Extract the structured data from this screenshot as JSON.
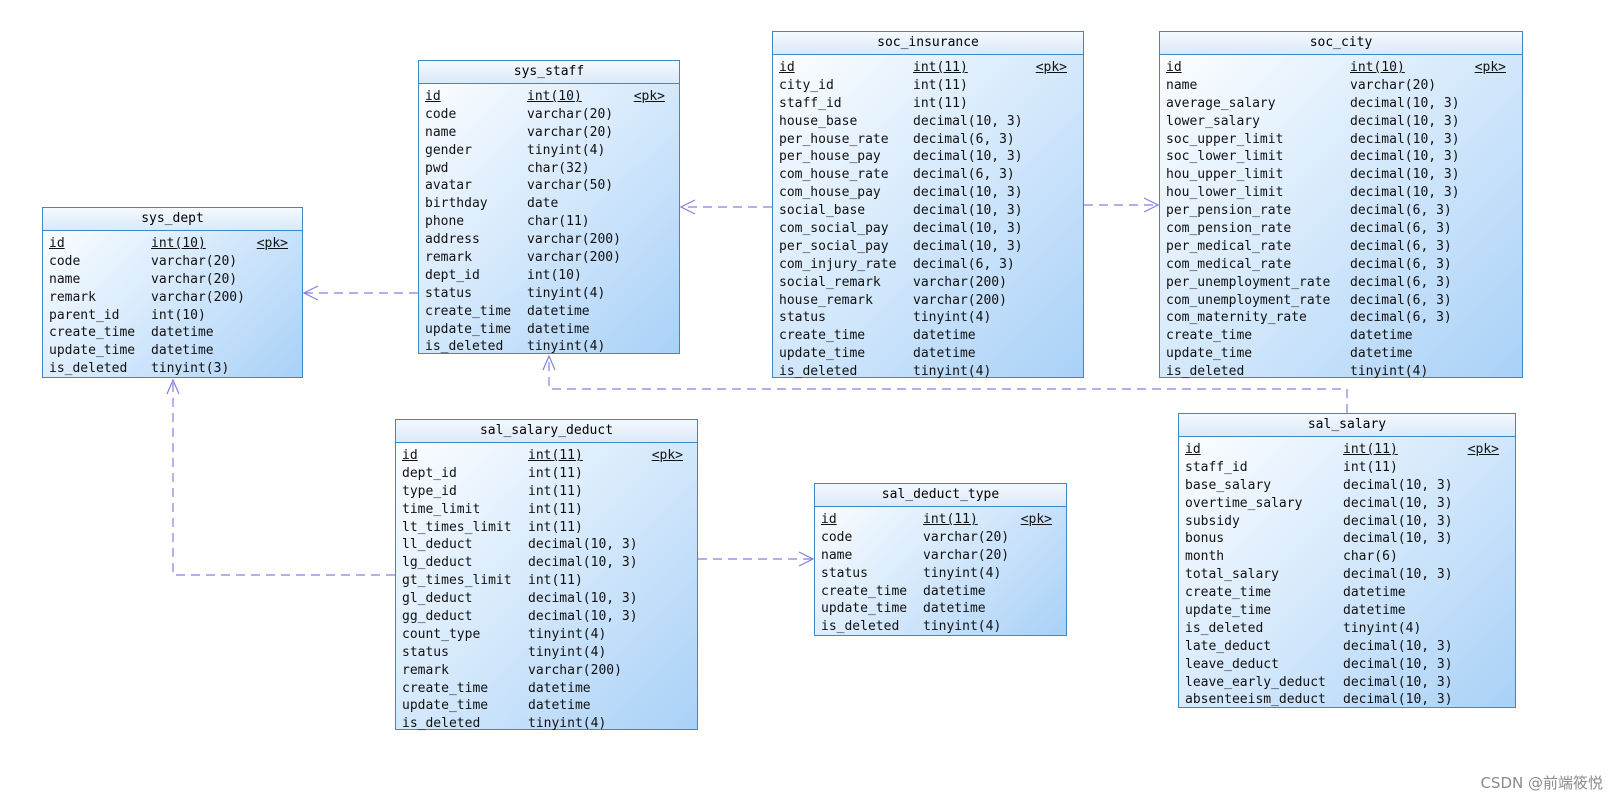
{
  "watermark": "CSDN @前端筱悦",
  "colors": {
    "link": "#8080e0",
    "border": "#3a89c9"
  },
  "entities": [
    {
      "key": "sys_dept",
      "title": "sys_dept",
      "columns": [
        {
          "name": "id",
          "type": "int(10)",
          "key": "<pk>"
        },
        {
          "name": "code",
          "type": "varchar(20)"
        },
        {
          "name": "name",
          "type": "varchar(20)"
        },
        {
          "name": "remark",
          "type": "varchar(200)"
        },
        {
          "name": "parent_id",
          "type": "int(10)"
        },
        {
          "name": "create_time",
          "type": "datetime"
        },
        {
          "name": "update_time",
          "type": "datetime"
        },
        {
          "name": "is_deleted",
          "type": "tinyint(3)"
        }
      ]
    },
    {
      "key": "sys_staff",
      "title": "sys_staff",
      "columns": [
        {
          "name": "id",
          "type": "int(10)",
          "key": "<pk>"
        },
        {
          "name": "code",
          "type": "varchar(20)"
        },
        {
          "name": "name",
          "type": "varchar(20)"
        },
        {
          "name": "gender",
          "type": "tinyint(4)"
        },
        {
          "name": "pwd",
          "type": "char(32)"
        },
        {
          "name": "avatar",
          "type": "varchar(50)"
        },
        {
          "name": "birthday",
          "type": "date"
        },
        {
          "name": "phone",
          "type": "char(11)"
        },
        {
          "name": "address",
          "type": "varchar(200)"
        },
        {
          "name": "remark",
          "type": "varchar(200)"
        },
        {
          "name": "dept_id",
          "type": "int(10)"
        },
        {
          "name": "status",
          "type": "tinyint(4)"
        },
        {
          "name": "create_time",
          "type": "datetime"
        },
        {
          "name": "update_time",
          "type": "datetime"
        },
        {
          "name": "is_deleted",
          "type": "tinyint(4)"
        }
      ]
    },
    {
      "key": "soc_insurance",
      "title": "soc_insurance",
      "columns": [
        {
          "name": "id",
          "type": "int(11)",
          "key": "<pk>"
        },
        {
          "name": "city_id",
          "type": "int(11)"
        },
        {
          "name": "staff_id",
          "type": "int(11)"
        },
        {
          "name": "house_base",
          "type": "decimal(10, 3)"
        },
        {
          "name": "per_house_rate",
          "type": "decimal(6, 3)"
        },
        {
          "name": "per_house_pay",
          "type": "decimal(10, 3)"
        },
        {
          "name": "com_house_rate",
          "type": "decimal(6, 3)"
        },
        {
          "name": "com_house_pay",
          "type": "decimal(10, 3)"
        },
        {
          "name": "social_base",
          "type": "decimal(10, 3)"
        },
        {
          "name": "com_social_pay",
          "type": "decimal(10, 3)"
        },
        {
          "name": "per_social_pay",
          "type": "decimal(10, 3)"
        },
        {
          "name": "com_injury_rate",
          "type": "decimal(6, 3)"
        },
        {
          "name": "social_remark",
          "type": "varchar(200)"
        },
        {
          "name": "house_remark",
          "type": "varchar(200)"
        },
        {
          "name": "status",
          "type": "tinyint(4)"
        },
        {
          "name": "create_time",
          "type": "datetime"
        },
        {
          "name": "update_time",
          "type": "datetime"
        },
        {
          "name": "is_deleted",
          "type": "tinyint(4)"
        }
      ]
    },
    {
      "key": "soc_city",
      "title": "soc_city",
      "columns": [
        {
          "name": "id",
          "type": "int(10)",
          "key": "<pk>"
        },
        {
          "name": "name",
          "type": "varchar(20)"
        },
        {
          "name": "average_salary",
          "type": "decimal(10, 3)"
        },
        {
          "name": "lower_salary",
          "type": "decimal(10, 3)"
        },
        {
          "name": "soc_upper_limit",
          "type": "decimal(10, 3)"
        },
        {
          "name": "soc_lower_limit",
          "type": "decimal(10, 3)"
        },
        {
          "name": "hou_upper_limit",
          "type": "decimal(10, 3)"
        },
        {
          "name": "hou_lower_limit",
          "type": "decimal(10, 3)"
        },
        {
          "name": "per_pension_rate",
          "type": "decimal(6, 3)"
        },
        {
          "name": "com_pension_rate",
          "type": "decimal(6, 3)"
        },
        {
          "name": "per_medical_rate",
          "type": "decimal(6, 3)"
        },
        {
          "name": "com_medical_rate",
          "type": "decimal(6, 3)"
        },
        {
          "name": "per_unemployment_rate",
          "type": "decimal(6, 3)"
        },
        {
          "name": "com_unemployment_rate",
          "type": "decimal(6, 3)"
        },
        {
          "name": "com_maternity_rate",
          "type": "decimal(6, 3)"
        },
        {
          "name": "create_time",
          "type": "datetime"
        },
        {
          "name": "update_time",
          "type": "datetime"
        },
        {
          "name": "is_deleted",
          "type": "tinyint(4)"
        }
      ]
    },
    {
      "key": "sal_salary_deduct",
      "title": "sal_salary_deduct",
      "columns": [
        {
          "name": "id",
          "type": "int(11)",
          "key": "<pk>"
        },
        {
          "name": "dept_id",
          "type": "int(11)"
        },
        {
          "name": "type_id",
          "type": "int(11)"
        },
        {
          "name": "time_limit",
          "type": "int(11)"
        },
        {
          "name": "lt_times_limit",
          "type": "int(11)"
        },
        {
          "name": "ll_deduct",
          "type": "decimal(10, 3)"
        },
        {
          "name": "lg_deduct",
          "type": "decimal(10, 3)"
        },
        {
          "name": "gt_times_limit",
          "type": "int(11)"
        },
        {
          "name": "gl_deduct",
          "type": "decimal(10, 3)"
        },
        {
          "name": "gg_deduct",
          "type": "decimal(10, 3)"
        },
        {
          "name": "count_type",
          "type": "tinyint(4)"
        },
        {
          "name": "status",
          "type": "tinyint(4)"
        },
        {
          "name": "remark",
          "type": "varchar(200)"
        },
        {
          "name": "create_time",
          "type": "datetime"
        },
        {
          "name": "update_time",
          "type": "datetime"
        },
        {
          "name": "is_deleted",
          "type": "tinyint(4)"
        }
      ]
    },
    {
      "key": "sal_deduct_type",
      "title": "sal_deduct_type",
      "columns": [
        {
          "name": "id",
          "type": "int(11)",
          "key": "<pk>"
        },
        {
          "name": "code",
          "type": "varchar(20)"
        },
        {
          "name": "name",
          "type": "varchar(20)"
        },
        {
          "name": "status",
          "type": "tinyint(4)"
        },
        {
          "name": "create_time",
          "type": "datetime"
        },
        {
          "name": "update_time",
          "type": "datetime"
        },
        {
          "name": "is_deleted",
          "type": "tinyint(4)"
        }
      ]
    },
    {
      "key": "sal_salary",
      "title": "sal_salary",
      "columns": [
        {
          "name": "id",
          "type": "int(11)",
          "key": "<pk>"
        },
        {
          "name": "staff_id",
          "type": "int(11)"
        },
        {
          "name": "base_salary",
          "type": "decimal(10, 3)"
        },
        {
          "name": "overtime_salary",
          "type": "decimal(10, 3)"
        },
        {
          "name": "subsidy",
          "type": "decimal(10, 3)"
        },
        {
          "name": "bonus",
          "type": "decimal(10, 3)"
        },
        {
          "name": "month",
          "type": "char(6)"
        },
        {
          "name": "total_salary",
          "type": "decimal(10, 3)"
        },
        {
          "name": "create_time",
          "type": "datetime"
        },
        {
          "name": "update_time",
          "type": "datetime"
        },
        {
          "name": "is_deleted",
          "type": "tinyint(4)"
        },
        {
          "name": "late_deduct",
          "type": "decimal(10, 3)"
        },
        {
          "name": "leave_deduct",
          "type": "decimal(10, 3)"
        },
        {
          "name": "leave_early_deduct",
          "type": "decimal(10, 3)"
        },
        {
          "name": "absenteeism_deduct",
          "type": "decimal(10, 3)"
        }
      ]
    }
  ],
  "relationships": [
    {
      "from": "sys_staff",
      "to": "sys_dept"
    },
    {
      "from": "soc_insurance",
      "to": "sys_staff"
    },
    {
      "from": "soc_insurance",
      "to": "soc_city"
    },
    {
      "from": "sal_salary",
      "to": "sys_staff"
    },
    {
      "from": "sal_salary_deduct",
      "to": "sys_dept"
    },
    {
      "from": "sal_salary_deduct",
      "to": "sal_deduct_type"
    }
  ]
}
